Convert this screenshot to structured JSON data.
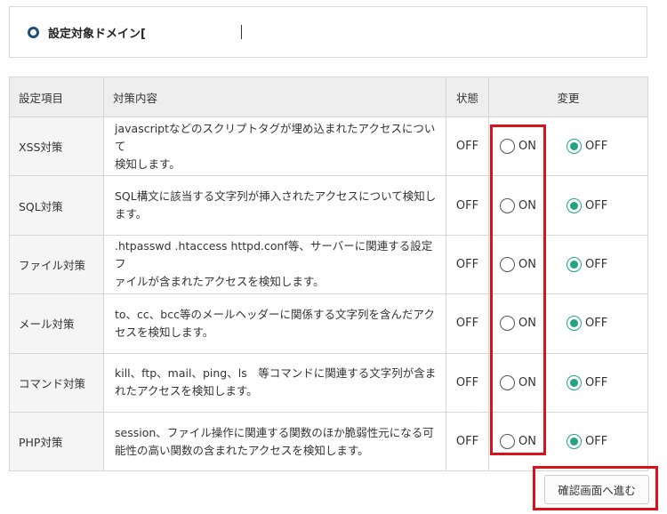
{
  "domain_section": {
    "label": "設定対象ドメイン["
  },
  "table": {
    "headers": {
      "item": "設定項目",
      "description": "対策内容",
      "status": "状態",
      "change": "変更"
    },
    "rows": [
      {
        "item": "XSS対策",
        "description_lines": [
          "javascriptなどのスクリプトタグが埋め込まれたアクセスについて",
          "検知します。"
        ],
        "status": "OFF",
        "on_label": "ON",
        "off_label": "OFF",
        "selected": "OFF"
      },
      {
        "item": "SQL対策",
        "description_lines": [
          "SQL構文に該当する文字列が挿入されたアクセスについて検知し",
          "ます。"
        ],
        "status": "OFF",
        "on_label": "ON",
        "off_label": "OFF",
        "selected": "OFF"
      },
      {
        "item": "ファイル対策",
        "description_lines": [
          ".htpasswd .htaccess httpd.conf等、サーバーに関連する設定フ",
          "ァイルが含まれたアクセスを検知します。"
        ],
        "status": "OFF",
        "on_label": "ON",
        "off_label": "OFF",
        "selected": "OFF"
      },
      {
        "item": "メール対策",
        "description_lines": [
          "to、cc、bcc等のメールヘッダーに関係する文字列を含んだアク",
          "セスを検知します。"
        ],
        "status": "OFF",
        "on_label": "ON",
        "off_label": "OFF",
        "selected": "OFF"
      },
      {
        "item": "コマンド対策",
        "description_lines": [
          "kill、ftp、mail、ping、ls　等コマンドに関連する文字列が含ま",
          "れたアクセスを検知します。"
        ],
        "status": "OFF",
        "on_label": "ON",
        "off_label": "OFF",
        "selected": "OFF"
      },
      {
        "item": "PHP対策",
        "description_lines": [
          "session、ファイル操作に関連する関数のほか脆弱性元になる可",
          "能性の高い関数の含まれたアクセスを検知します。"
        ],
        "status": "OFF",
        "on_label": "ON",
        "off_label": "OFF",
        "selected": "OFF"
      }
    ]
  },
  "actions": {
    "confirm_label": "確認画面へ進む"
  },
  "colors": {
    "radio_checked": "#23a383",
    "highlight": "#d9121b",
    "domain_icon": "#1d4d79"
  }
}
